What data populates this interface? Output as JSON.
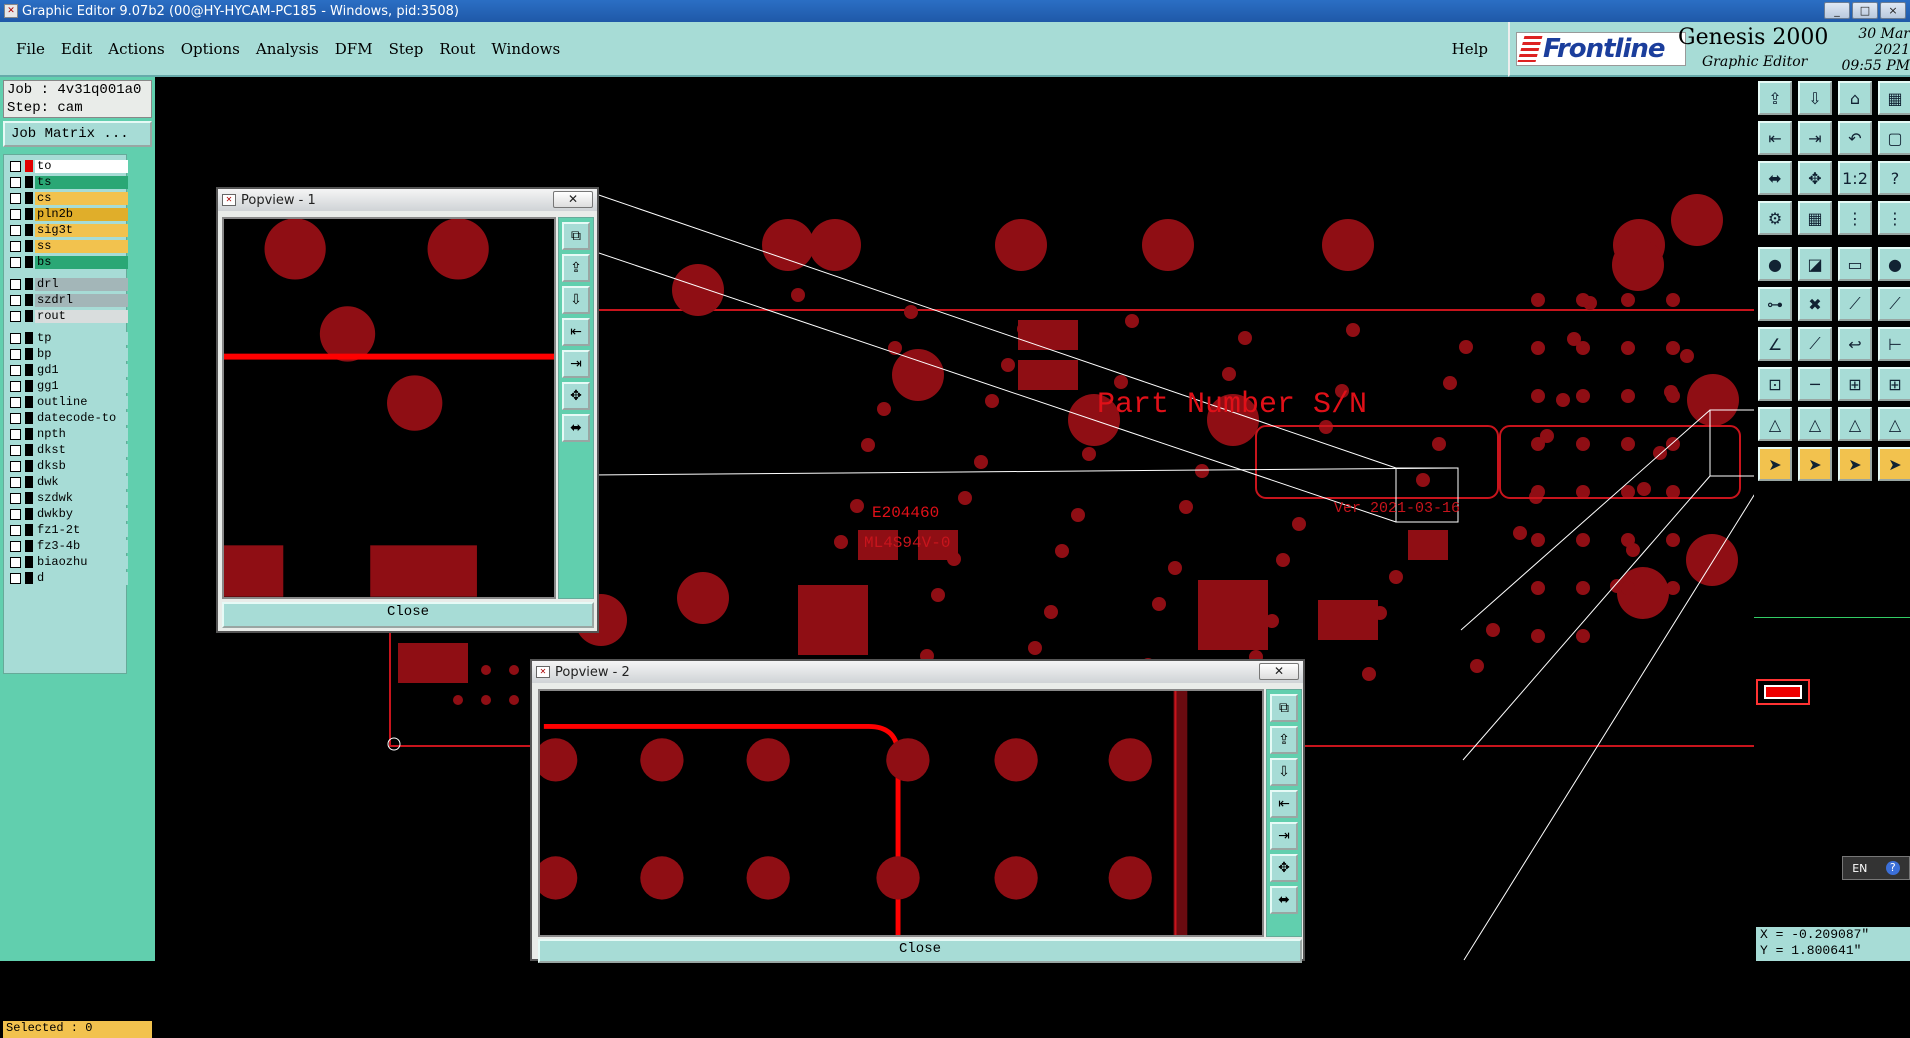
{
  "window": {
    "title": "Graphic Editor 9.07b2 (00@HY-HYCAM-PC185 - Windows, pid:3508)",
    "min": "_",
    "max": "□",
    "close": "×"
  },
  "menu": {
    "items": [
      {
        "label": "File"
      },
      {
        "label": "Edit"
      },
      {
        "label": "Actions"
      },
      {
        "label": "Options"
      },
      {
        "label": "Analysis"
      },
      {
        "label": "DFM"
      },
      {
        "label": "Step"
      },
      {
        "label": "Rout"
      },
      {
        "label": "Windows"
      }
    ],
    "help": "Help"
  },
  "brand": {
    "logo": "Frontline",
    "product": "Genesis 2000",
    "subtitle": "Graphic Editor",
    "date": "30 Mar 2021",
    "time": "09:55 PM"
  },
  "left": {
    "job": "Job : 4v31q001a0",
    "step": "Step: cam",
    "job_matrix": "Job Matrix ...",
    "selected": "Selected : 0",
    "layers": [
      {
        "name": "to",
        "color": "#ffffff",
        "mark": "#e00000"
      },
      {
        "name": "ts",
        "color": "#2aa775"
      },
      {
        "name": "cs",
        "color": "#f2c24e"
      },
      {
        "name": "pln2b",
        "color": "#e0ae2a"
      },
      {
        "name": "sig3t",
        "color": "#f2c24e"
      },
      {
        "name": "ss",
        "color": "#f2c24e"
      },
      {
        "name": "bs",
        "color": "#2aa775"
      },
      {
        "name": "drl",
        "color": "#a3b6b8"
      },
      {
        "name": "szdrl",
        "color": "#a3b6b8"
      },
      {
        "name": "rout",
        "color": "#d9dddd"
      },
      {
        "name": "tp",
        "color": "#a7dcd6"
      },
      {
        "name": "bp",
        "color": "#a7dcd6"
      },
      {
        "name": "gd1",
        "color": "#a7dcd6"
      },
      {
        "name": "gg1",
        "color": "#a7dcd6"
      },
      {
        "name": "outline",
        "color": "#a7dcd6"
      },
      {
        "name": "datecode-to",
        "color": "#a7dcd6"
      },
      {
        "name": "npth",
        "color": "#a7dcd6"
      },
      {
        "name": "dkst",
        "color": "#a7dcd6"
      },
      {
        "name": "dksb",
        "color": "#a7dcd6"
      },
      {
        "name": "dwk",
        "color": "#a7dcd6"
      },
      {
        "name": "szdwk",
        "color": "#a7dcd6"
      },
      {
        "name": "dwkby",
        "color": "#a7dcd6"
      },
      {
        "name": "fz1-2t",
        "color": "#a7dcd6"
      },
      {
        "name": "fz3-4b",
        "color": "#a7dcd6"
      },
      {
        "name": "biaozhu",
        "color": "#a7dcd6"
      },
      {
        "name": "d",
        "color": "#a7dcd6"
      }
    ]
  },
  "board": {
    "part_number": "Part Number S/N",
    "e_code": "E204460",
    "ml": "ML4S94V-0",
    "date_label": "Ver 2021-03-16",
    "accent": "#c8141c"
  },
  "popview1": {
    "title": "Popview - 1",
    "close": "Close"
  },
  "popview2": {
    "title": "Popview - 2",
    "close": "Close"
  },
  "coords": {
    "x": "X = -0.209087\"",
    "y": "Y = 1.800641\""
  },
  "tray": {
    "lang": "EN",
    "help": "?"
  }
}
